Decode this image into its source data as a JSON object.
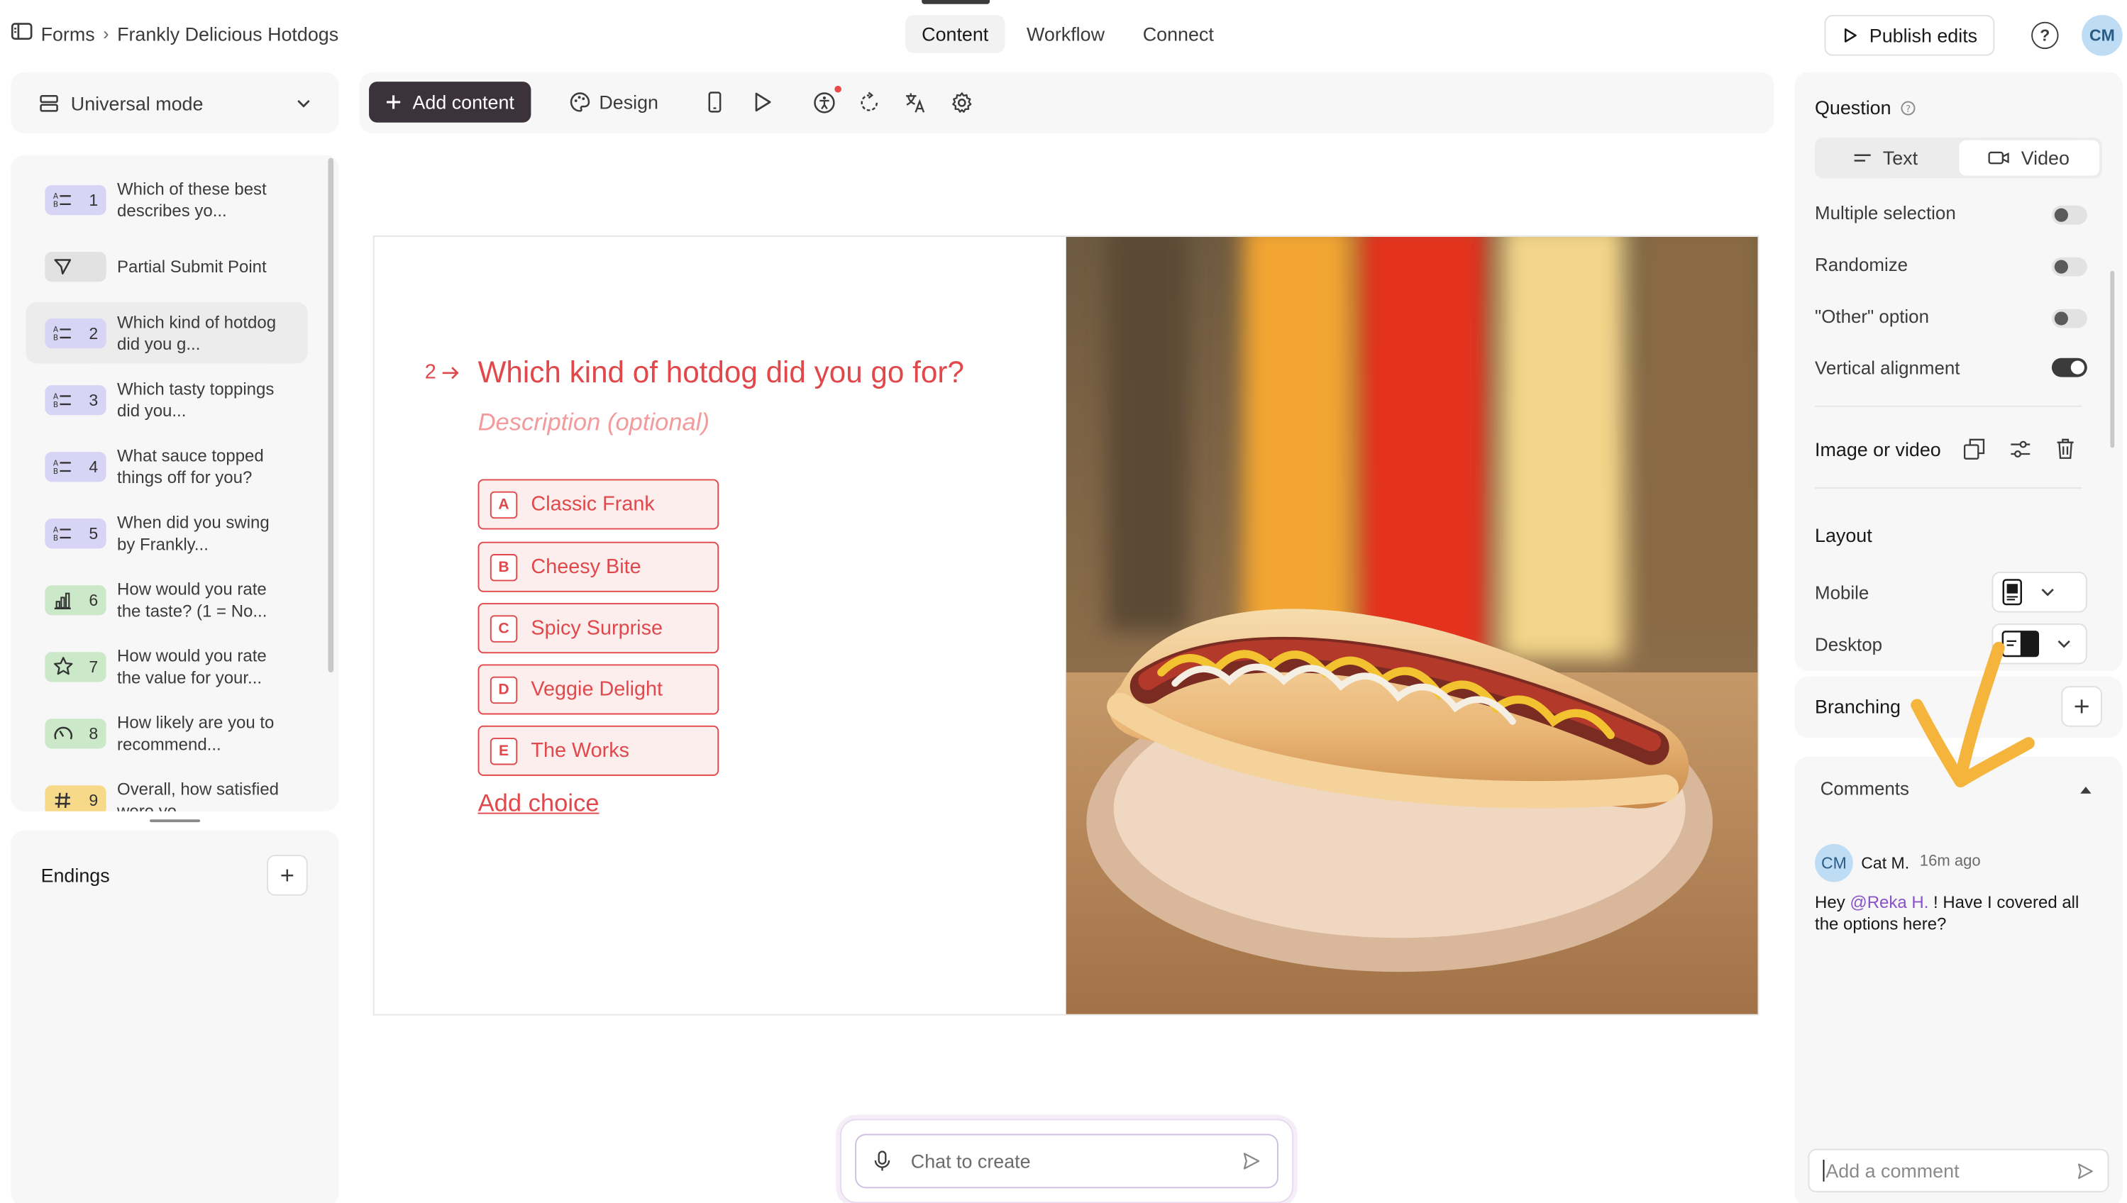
{
  "breadcrumb": {
    "root": "Forms",
    "separator": "›",
    "current": "Frankly Delicious Hotdogs"
  },
  "nav_tabs": [
    {
      "label": "Content",
      "active": true
    },
    {
      "label": "Workflow",
      "active": false
    },
    {
      "label": "Connect",
      "active": false
    }
  ],
  "header": {
    "publish_label": "Publish edits",
    "help": "?",
    "avatar_initials": "CM"
  },
  "mode_selector": {
    "label": "Universal mode"
  },
  "questions": [
    {
      "number": "1",
      "text": "Which of these best describes yo...",
      "type_icon": "list-icon",
      "badge": "purple",
      "selected": false
    },
    {
      "number": "",
      "text": "Partial Submit Point",
      "type_icon": "send-icon",
      "badge": "grey",
      "selected": false
    },
    {
      "number": "2",
      "text": "Which kind of hotdog did you g...",
      "type_icon": "list-icon",
      "badge": "purple",
      "selected": true
    },
    {
      "number": "3",
      "text": "Which tasty toppings did you...",
      "type_icon": "list-icon",
      "badge": "purple",
      "selected": false
    },
    {
      "number": "4",
      "text": "What sauce topped things off for you?",
      "type_icon": "list-icon",
      "badge": "purple",
      "selected": false
    },
    {
      "number": "5",
      "text": "When did you swing by Frankly...",
      "type_icon": "list-icon",
      "badge": "purple",
      "selected": false
    },
    {
      "number": "6",
      "text": "How would you rate the taste? (1 = No...",
      "type_icon": "bar-chart-icon",
      "badge": "green",
      "selected": false
    },
    {
      "number": "7",
      "text": "How would you rate the value for your...",
      "type_icon": "star-icon",
      "badge": "green",
      "selected": false
    },
    {
      "number": "8",
      "text": "How likely are you to recommend...",
      "type_icon": "gauge-icon",
      "badge": "green",
      "selected": false
    },
    {
      "number": "9",
      "text": "Overall, how satisfied were yo...",
      "type_icon": "hash-icon",
      "badge": "yellow",
      "selected": false
    }
  ],
  "endings": {
    "label": "Endings",
    "add": "+"
  },
  "toolbar": {
    "add_content_label": "Add content",
    "design_label": "Design"
  },
  "canvas": {
    "question_number": "2",
    "question_title": "Which kind of hotdog did you go for?",
    "description_placeholder": "Description (optional)",
    "choices": [
      {
        "key": "A",
        "label": "Classic Frank"
      },
      {
        "key": "B",
        "label": "Cheesy Bite"
      },
      {
        "key": "C",
        "label": "Spicy Surprise"
      },
      {
        "key": "D",
        "label": "Veggie Delight"
      },
      {
        "key": "E",
        "label": "The Works"
      }
    ],
    "add_choice_label": "Add choice",
    "accent_color": "#e0484b"
  },
  "chat": {
    "placeholder": "Chat to create"
  },
  "right_panel": {
    "question_heading": "Question",
    "question_type_tabs": [
      {
        "label": "Text",
        "active": true
      },
      {
        "label": "Video",
        "active": false
      }
    ],
    "settings": [
      {
        "label": "Multiple selection",
        "on": false
      },
      {
        "label": "Randomize",
        "on": false
      },
      {
        "label": "\"Other\" option",
        "on": false
      },
      {
        "label": "Vertical alignment",
        "on": true
      }
    ],
    "image_or_video_label": "Image or video",
    "layout_heading": "Layout",
    "layout_rows": [
      {
        "label": "Mobile"
      },
      {
        "label": "Desktop"
      }
    ],
    "branching_label": "Branching",
    "comments_heading": "Comments",
    "comment": {
      "avatar": "CM",
      "author": "Cat M.",
      "time": "16m ago",
      "text_before": "Hey ",
      "mention": "@Reka H.",
      "text_after": " ! Have I covered all the options here?"
    },
    "add_comment_placeholder": "Add a comment"
  },
  "annotation_color": "#f5b43c"
}
